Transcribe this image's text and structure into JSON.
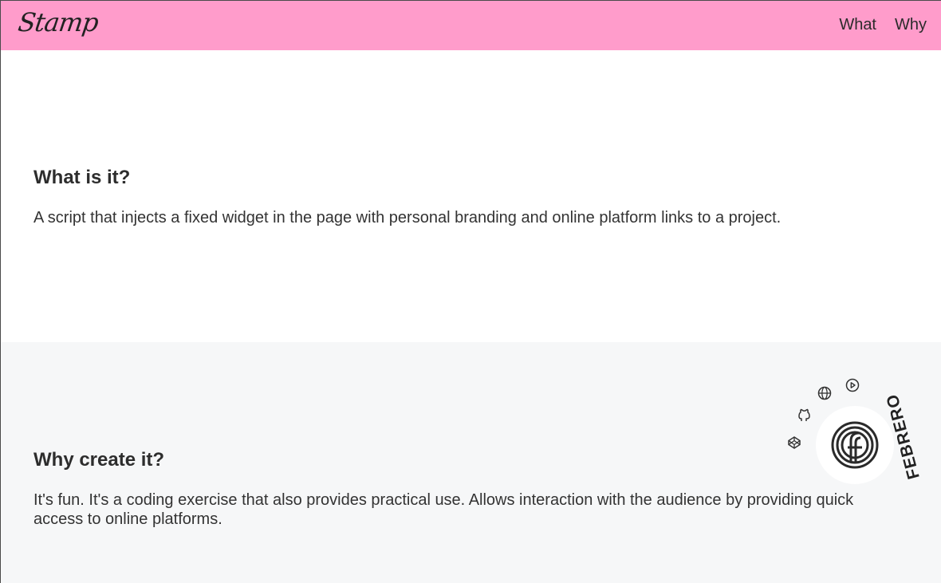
{
  "header": {
    "logo": "Stamp",
    "nav": [
      "What",
      "Why"
    ]
  },
  "sections": [
    {
      "title": "What is it?",
      "text": "A script that injects a fixed widget in the page with personal branding and online platform links to a project."
    },
    {
      "title": "Why create it?",
      "text": "It's fun. It's a coding exercise that also provides practical use. Allows interaction with the audience by providing quick access to online platforms."
    }
  ],
  "widget": {
    "brand_text": "FEBRERO",
    "icons": [
      "codepen-icon",
      "github-icon",
      "globe-icon",
      "play-icon"
    ],
    "colors": {
      "header_bg": "#ff9ccb",
      "section_alt_bg": "#f6f7f8"
    }
  }
}
